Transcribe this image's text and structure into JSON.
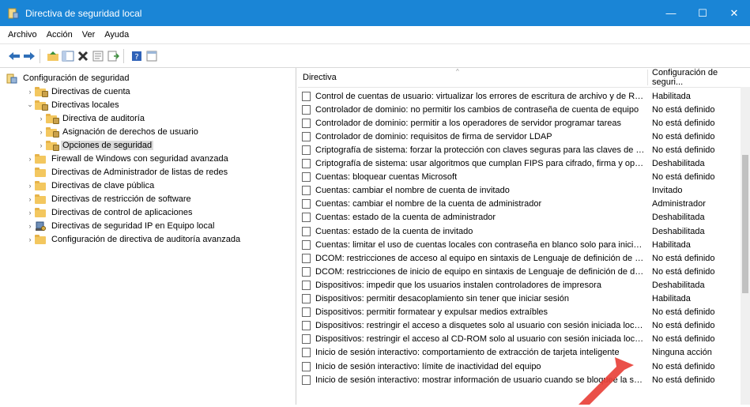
{
  "window": {
    "title": "Directiva de seguridad local",
    "minimize": "—",
    "maximize": "☐",
    "close": "✕",
    "accent": "#1a85d6"
  },
  "menu": [
    "Archivo",
    "Acción",
    "Ver",
    "Ayuda"
  ],
  "toolbar": [
    "back-arrow-icon",
    "forward-arrow-icon",
    "up-folder-icon",
    "show-hide-tree-icon",
    "delete-icon",
    "properties-icon",
    "export-list-icon",
    "help-icon",
    "view-icon"
  ],
  "tree": [
    {
      "label": "Configuración de seguridad",
      "arrow": "",
      "icon": "security-settings-icon",
      "indent": 0
    },
    {
      "label": "Directivas de cuenta",
      "arrow": "›",
      "icon": "folder-icon",
      "indent": 1
    },
    {
      "label": "Directivas locales",
      "arrow": "⌄",
      "icon": "folder-icon",
      "indent": 1
    },
    {
      "label": "Directiva de auditoría",
      "arrow": "›",
      "icon": "folder-icon",
      "indent": 2
    },
    {
      "label": "Asignación de derechos de usuario",
      "arrow": "›",
      "icon": "folder-icon",
      "indent": 2
    },
    {
      "label": "Opciones de seguridad",
      "arrow": "›",
      "icon": "folder-icon",
      "indent": 2,
      "selected": true
    },
    {
      "label": "Firewall de Windows con seguridad avanzada",
      "arrow": "›",
      "icon": "folder-icon",
      "indent": 1
    },
    {
      "label": "Directivas de Administrador de listas de redes",
      "arrow": "",
      "icon": "folder-icon",
      "indent": 1
    },
    {
      "label": "Directivas de clave pública",
      "arrow": "›",
      "icon": "folder-icon",
      "indent": 1
    },
    {
      "label": "Directivas de restricción de software",
      "arrow": "›",
      "icon": "folder-icon",
      "indent": 1
    },
    {
      "label": "Directivas de control de aplicaciones",
      "arrow": "›",
      "icon": "folder-icon",
      "indent": 1
    },
    {
      "label": "Directivas de seguridad IP en Equipo local",
      "arrow": "›",
      "icon": "ip-security-icon",
      "indent": 1
    },
    {
      "label": "Configuración de directiva de auditoría avanzada",
      "arrow": "›",
      "icon": "folder-icon",
      "indent": 1
    }
  ],
  "list": {
    "headers": {
      "policy": "Directiva",
      "setting": "Configuración de seguri..."
    },
    "rows": [
      {
        "policy": "Control de cuentas de usuario: virtualizar los errores de escritura de archivo y de Registro e...",
        "setting": "Habilitada"
      },
      {
        "policy": "Controlador de dominio: no permitir los cambios de contraseña de cuenta de equipo",
        "setting": "No está definido"
      },
      {
        "policy": "Controlador de dominio: permitir a los operadores de servidor programar tareas",
        "setting": "No está definido"
      },
      {
        "policy": "Controlador de dominio: requisitos de firma de servidor LDAP",
        "setting": "No está definido"
      },
      {
        "policy": "Criptografía de sistema: forzar la protección con claves seguras para las claves de usuario a...",
        "setting": "No está definido"
      },
      {
        "policy": "Criptografía de sistema: usar algoritmos que cumplan FIPS para cifrado, firma y operacion...",
        "setting": "Deshabilitada"
      },
      {
        "policy": "Cuentas: bloquear cuentas Microsoft",
        "setting": "No está definido"
      },
      {
        "policy": "Cuentas: cambiar el nombre de cuenta de invitado",
        "setting": "Invitado"
      },
      {
        "policy": "Cuentas: cambiar el nombre de la cuenta de administrador",
        "setting": "Administrador"
      },
      {
        "policy": "Cuentas: estado de la cuenta de administrador",
        "setting": "Deshabilitada"
      },
      {
        "policy": "Cuentas: estado de la cuenta de invitado",
        "setting": "Deshabilitada"
      },
      {
        "policy": "Cuentas: limitar el uso de cuentas locales con contraseña en blanco solo para iniciar sesión...",
        "setting": "Habilitada"
      },
      {
        "policy": "DCOM: restricciones de acceso al equipo en sintaxis de Lenguaje de definición de descript...",
        "setting": "No está definido"
      },
      {
        "policy": "DCOM: restricciones de inicio de equipo en sintaxis de Lenguaje de definición de descripto...",
        "setting": "No está definido"
      },
      {
        "policy": "Dispositivos: impedir que los usuarios instalen controladores de impresora",
        "setting": "Deshabilitada"
      },
      {
        "policy": "Dispositivos: permitir desacoplamiento sin tener que iniciar sesión",
        "setting": "Habilitada"
      },
      {
        "policy": "Dispositivos: permitir formatear y expulsar medios extraíbles",
        "setting": "No está definido"
      },
      {
        "policy": "Dispositivos: restringir el acceso a disquetes solo al usuario con sesión iniciada localmente",
        "setting": "No está definido"
      },
      {
        "policy": "Dispositivos: restringir el acceso al CD-ROM solo al usuario con sesión iniciada localmente",
        "setting": "No está definido"
      },
      {
        "policy": "Inicio de sesión interactivo: comportamiento de extracción de tarjeta inteligente",
        "setting": "Ninguna acción"
      },
      {
        "policy": "Inicio de sesión interactivo: límite de inactividad del equipo",
        "setting": "No está definido"
      },
      {
        "policy": "Inicio de sesión interactivo: mostrar información de usuario cuando se bloquee la sesión",
        "setting": "No está definido"
      }
    ]
  },
  "annotation": {
    "icon": "red-arrow-icon",
    "color": "#e8413a"
  }
}
